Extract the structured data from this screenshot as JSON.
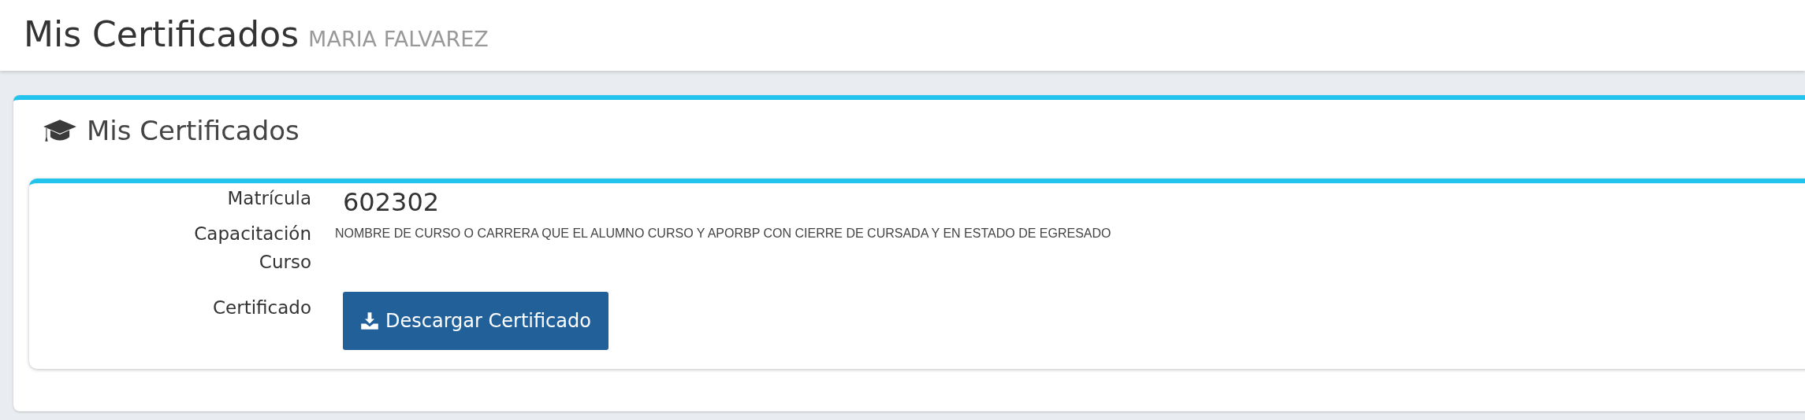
{
  "header": {
    "title": "Mis Certificados",
    "subtitle": "MARIA FALVAREZ"
  },
  "panel": {
    "title": "Mis Certificados",
    "rows": [
      {
        "kind": "value",
        "label": "Matrícula",
        "value": "602302"
      },
      {
        "kind": "text",
        "label": "Capacitación Curso",
        "value": "NOMBRE DE CURSO O CARRERA QUE EL ALUMNO CURSO Y APORBP CON CIERRE DE CURSADA Y EN ESTADO DE EGRESADO"
      },
      {
        "kind": "button",
        "label": "Certificado",
        "value": "Descargar Certificado"
      }
    ]
  }
}
